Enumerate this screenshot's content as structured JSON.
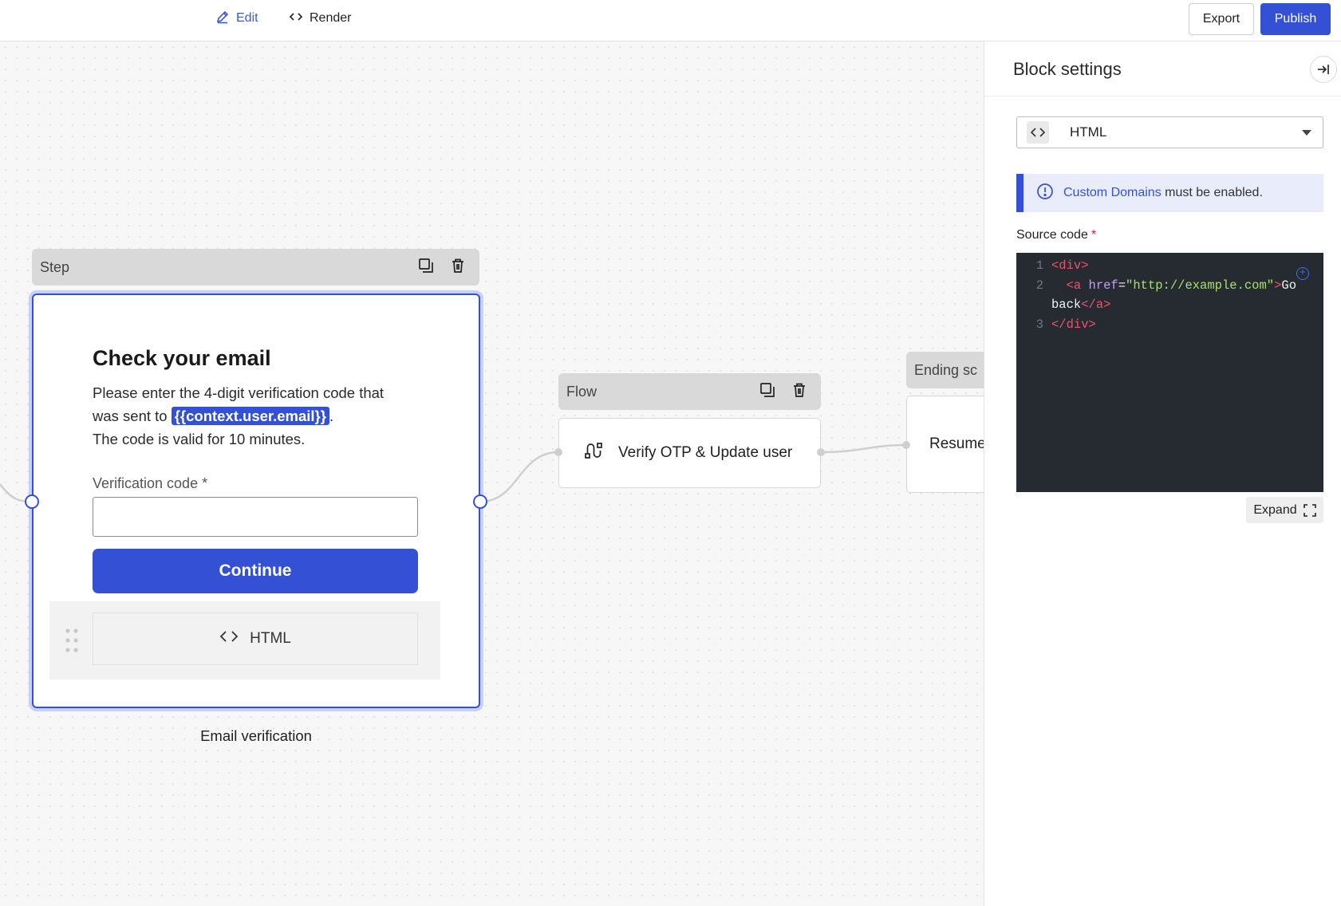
{
  "toolbar": {
    "tabs": [
      {
        "label": "Edit",
        "icon": "pencil-icon",
        "active": true
      },
      {
        "label": "Render",
        "icon": "code-icon",
        "active": false
      }
    ],
    "export_label": "Export",
    "publish_label": "Publish",
    "accent_color": "#3451d6"
  },
  "canvas": {
    "step": {
      "header": "Step",
      "title": "Check your email",
      "desc_part1": "Please enter the 4-digit verification code that was sent to ",
      "variable_chip": "{{context.user.email}}",
      "desc_part2": ".",
      "desc_line3": "The code is valid for 10 minutes.",
      "field_label": "Verification code *",
      "field_value": "",
      "button_label": "Continue",
      "html_block_label": "HTML",
      "caption": "Email verification"
    },
    "flow": {
      "header": "Flow",
      "label": "Verify OTP & Update user"
    },
    "ending": {
      "header": "Ending sc",
      "label": "Resume"
    }
  },
  "panel": {
    "title": "Block settings",
    "block_type": "HTML",
    "notice_link": "Custom Domains",
    "notice_text": " must be enabled.",
    "source_label": "Source code",
    "required_mark": "*",
    "expand_label": "Expand",
    "code_lines": [
      {
        "num": "1",
        "tokens": [
          {
            "t": "tag",
            "v": "<div>"
          }
        ]
      },
      {
        "num": "2",
        "tokens": [
          {
            "t": "txt",
            "v": "  "
          },
          {
            "t": "tag",
            "v": "<a "
          },
          {
            "t": "attr",
            "v": "href"
          },
          {
            "t": "txt",
            "v": "="
          },
          {
            "t": "str",
            "v": "\"http://example.com\""
          },
          {
            "t": "tag",
            "v": ">"
          },
          {
            "t": "txt",
            "v": "Go"
          }
        ]
      },
      {
        "num": "",
        "tokens": [
          {
            "t": "txt",
            "v": "back"
          },
          {
            "t": "tag",
            "v": "</a>"
          }
        ]
      },
      {
        "num": "3",
        "tokens": [
          {
            "t": "tag",
            "v": "</div>"
          }
        ]
      }
    ]
  }
}
